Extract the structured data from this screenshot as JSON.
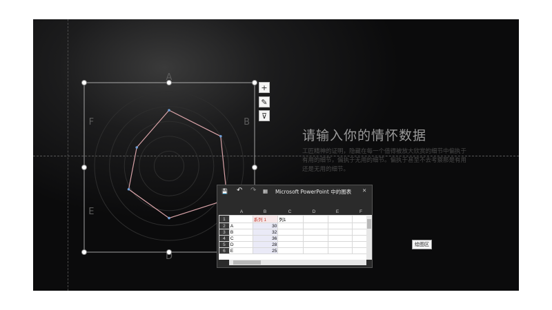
{
  "slide": {
    "title": "请输入你的情怀数据",
    "body": "工匠精神的证明，隐藏在每一个值得被放大欣赏的细节中偏执于有用的细节，偏执于无用的细节。偏执于甚至不去考察那是有用还是无用的细节。"
  },
  "chart_buttons": {
    "add": "+",
    "style": "✎",
    "filter": "⊽"
  },
  "plot_area_tip": "绘图区",
  "chart_data": {
    "type": "radar",
    "categories": [
      "A",
      "B",
      "C",
      "D",
      "E",
      "F"
    ],
    "series": [
      {
        "name": "系列 1",
        "values": [
          30,
          32,
          36,
          28,
          25,
          20
        ]
      }
    ],
    "rlim": [
      0,
      40
    ],
    "grid": true,
    "colors": {
      "series": "#d9a3a8",
      "grid": "#2e2e2e",
      "markers": "#6f9fd6"
    }
  },
  "excel": {
    "title": "Microsoft PowerPoint 中的图表",
    "close": "✕",
    "save_icon": "💾",
    "undo": "↶",
    "redo": "↷",
    "sheet_icon": "▦",
    "columns": [
      "A",
      "B",
      "C",
      "D",
      "E",
      "F"
    ],
    "rows": [
      "1",
      "2",
      "3",
      "4",
      "5",
      "6"
    ],
    "header": [
      "",
      "系列 1",
      "列1"
    ],
    "data": [
      [
        "A",
        "30"
      ],
      [
        "B",
        "32"
      ],
      [
        "C",
        "36"
      ],
      [
        "D",
        "28"
      ],
      [
        "E",
        "25"
      ]
    ]
  }
}
